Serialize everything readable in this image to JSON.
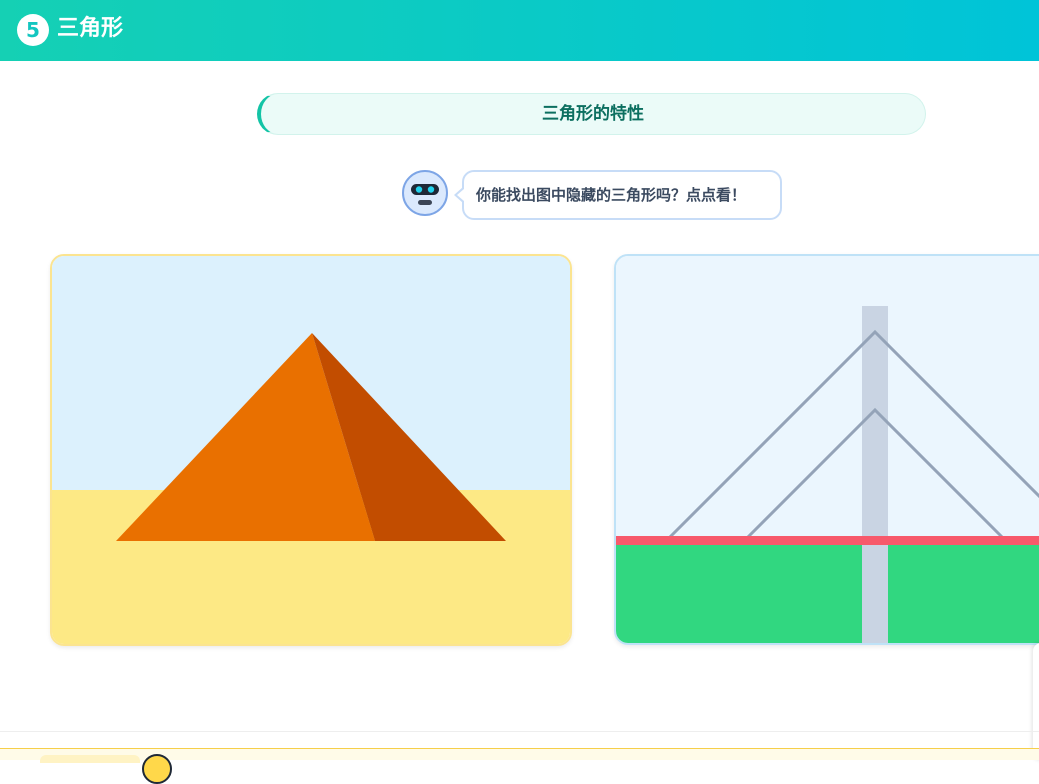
{
  "header": {
    "number": "5",
    "title": "三角形"
  },
  "section": {
    "title": "三角形的特性"
  },
  "assistant": {
    "prompt": "你能找出图中隐藏的三角形吗？点点看！"
  },
  "scenes": {
    "pyramid": {
      "sky_color": "#dcf1fd",
      "sand_color": "#fde985",
      "light_face_color": "#e97000",
      "dark_face_color": "#c24d00"
    },
    "bridge": {
      "sky_color": "#ebf6fe",
      "grass_color": "#31d780",
      "deck_color": "#f7596b",
      "tower_color": "#c9d4e3",
      "cable_color": "#94a3b8"
    }
  },
  "colors": {
    "header_gradient_start": "#15d0b4",
    "header_gradient_end": "#00c4d8",
    "accent": "#13c4a6",
    "section_text": "#0c6f60"
  }
}
